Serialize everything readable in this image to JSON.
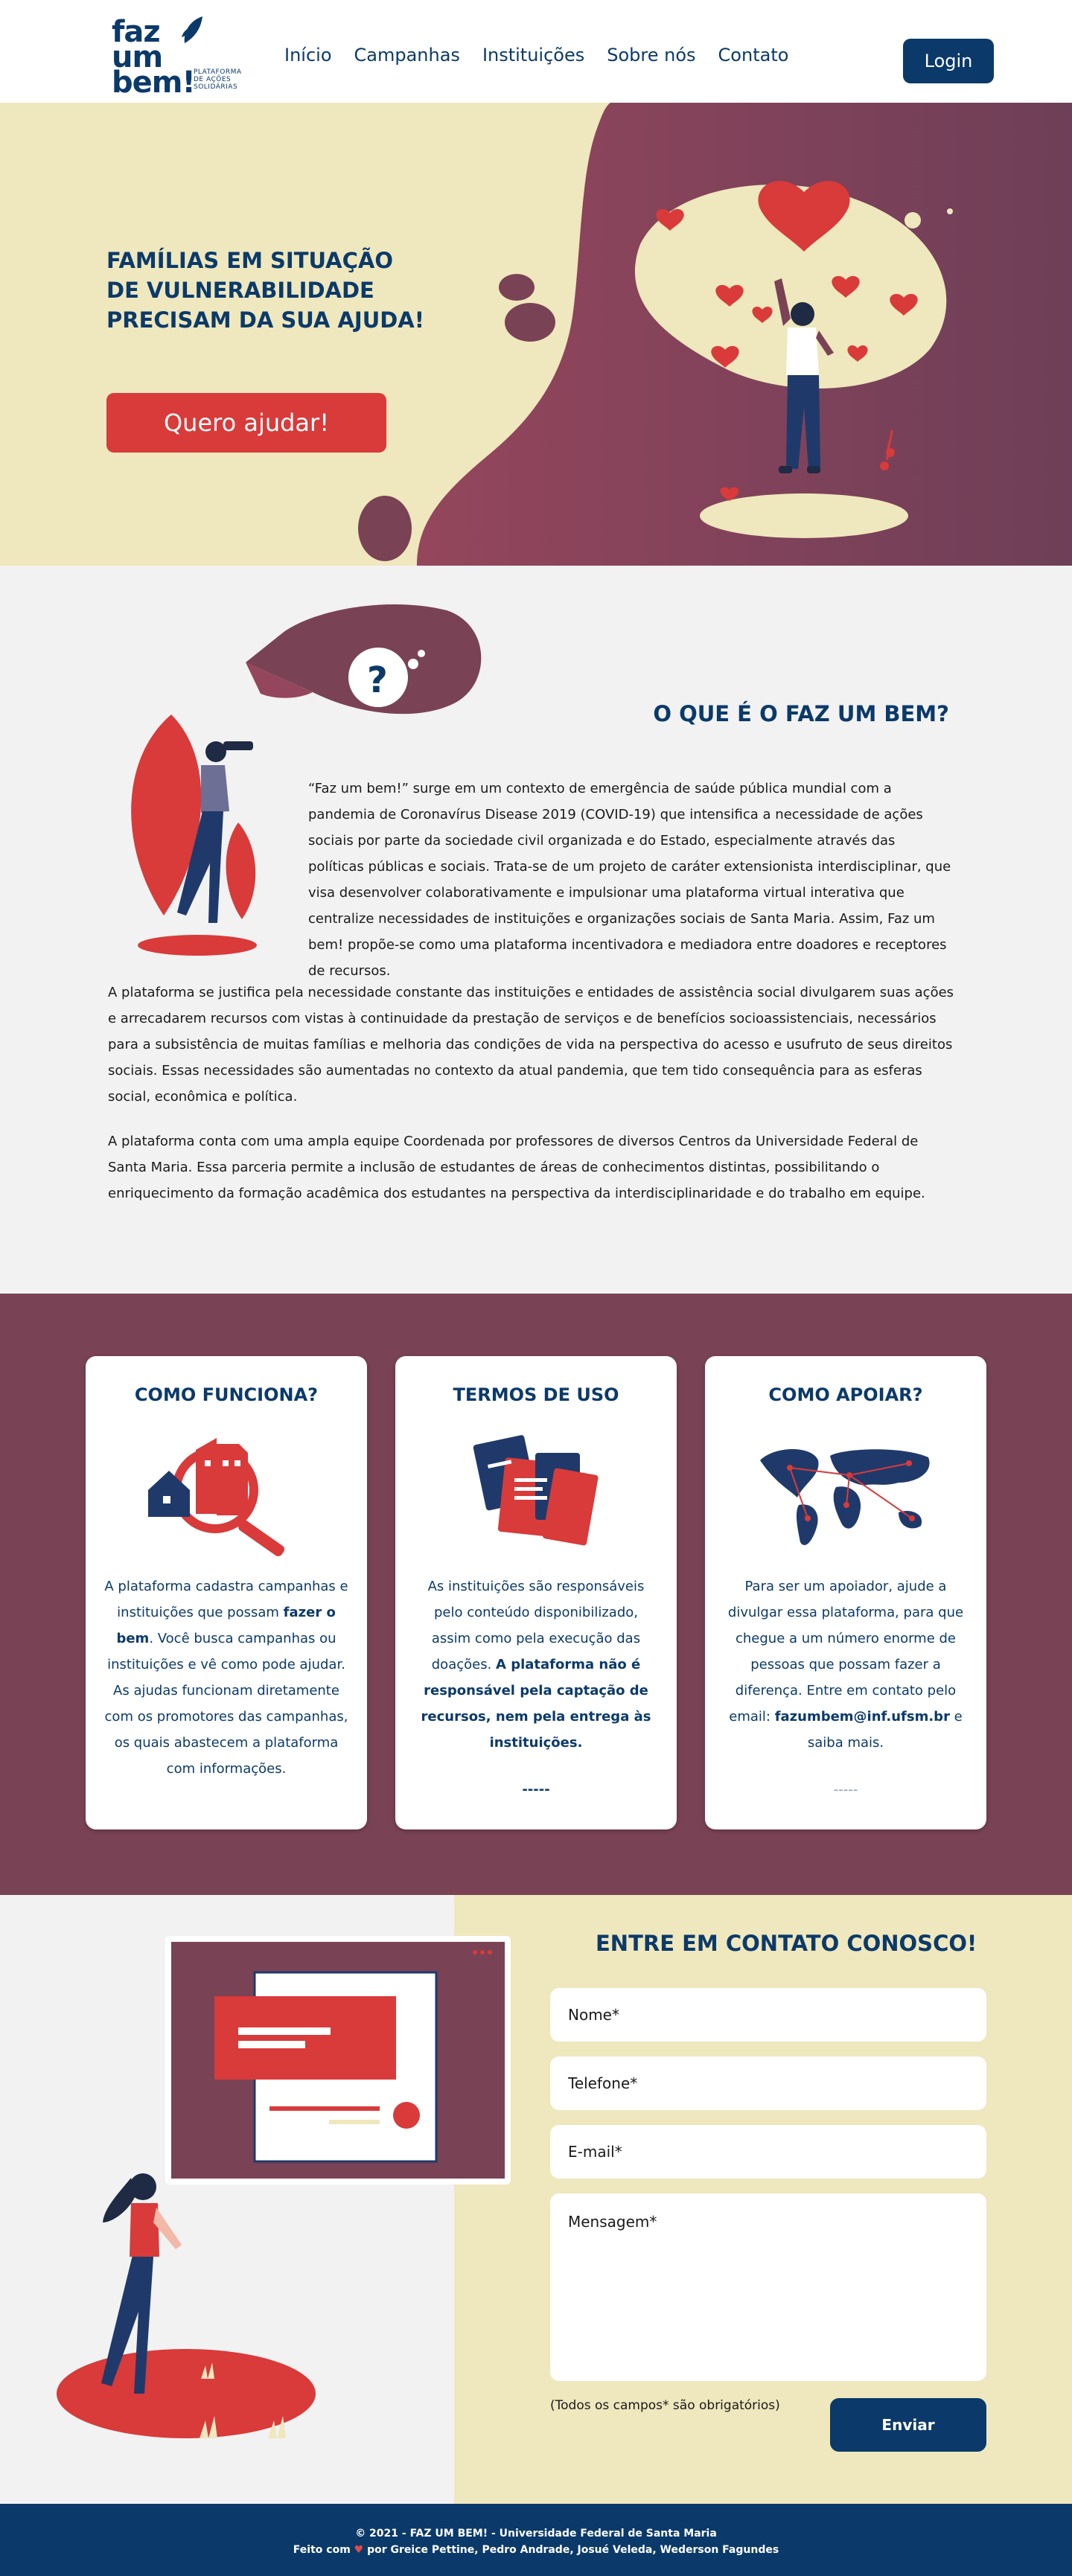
{
  "header": {
    "logo": {
      "word_line1": "faz",
      "word_line2": "um",
      "word_line3": "bem!",
      "subtitle": "PLATAFORMA DE AÇÕES SOLIDÁRIAS"
    },
    "nav": [
      "Início",
      "Campanhas",
      "Instituições",
      "Sobre nós",
      "Contato"
    ],
    "login_label": "Login"
  },
  "hero": {
    "line1": "FAMÍLIAS EM SITUAÇÃO",
    "line2_pre": "DE ",
    "line2_bold": "VULNERABILIDADE",
    "line3_pre": "PRECISAM DA ",
    "line3_bold": "SUA AJUDA!",
    "cta_label": "Quero ajudar!"
  },
  "about": {
    "title_pre": "O QUE É O ",
    "title_bold": "FAZ UM BEM?",
    "p1": "“Faz um bem!” surge em um contexto de emergência de saúde pública mundial com a pandemia de Coronavírus Disease 2019 (COVID-19) que intensifica a necessidade de ações sociais por parte da sociedade civil organizada e do Estado, especialmente através das políticas públicas e sociais. Trata-se de um projeto de caráter extensionista interdisciplinar, que visa desenvolver colaborativamente e impulsionar uma plataforma virtual interativa que centralize necessidades de instituições e organizações sociais de Santa Maria. Assim, Faz um bem! propõe-se como uma plataforma incentivadora e mediadora entre doadores e receptores de recursos.",
    "p2": "A plataforma se justifica pela necessidade constante das instituições e entidades de assistência social divulgarem suas ações e arrecadarem recursos com vistas à continuidade da prestação de serviços e de benefícios socioassistenciais, necessários para a subsistência de muitas famílias e melhoria das condições de vida na perspectiva do acesso e usufruto de seus direitos sociais. Essas necessidades são aumentadas no contexto da atual pandemia, que tem tido consequência para as esferas social, econômica e política.",
    "p3": "A plataforma conta com uma ampla equipe Coordenada por professores de diversos Centros da Universidade Federal de Santa Maria. Essa parceria permite a inclusão de estudantes de áreas de conhecimentos distintas, possibilitando o enriquecimento da formação acadêmica dos estudantes na perspectiva da interdisciplinaridade e do trabalho em equipe."
  },
  "cards": [
    {
      "title": "COMO FUNCIONA?",
      "icon": "house-magnifier-icon",
      "text_pre": "A plataforma cadastra campanhas e instituições que possam ",
      "text_bold": "fazer o bem",
      "text_post": ". Você busca campanhas ou instituições e vê como pode ajudar. As ajudas funcionam diretamente com os promotores das campanhas, os quais abastecem a plataforma com informações.",
      "footer": ""
    },
    {
      "title": "TERMOS DE USO",
      "icon": "documents-icon",
      "text_pre": "As instituições são responsáveis pelo conteúdo disponibilizado, assim como pela execução das doações.  ",
      "text_bold": "A plataforma não é responsável pela captação de recursos, nem pela entrega às instituições.",
      "text_post": "",
      "footer": "-----"
    },
    {
      "title": "COMO APOIAR?",
      "icon": "world-map-icon",
      "text_pre": "Para ser um apoiador, ajude a divulgar essa plataforma, para que chegue a um número enorme de pessoas que possam fazer a diferença. Entre em contato pelo email: ",
      "text_bold": "fazumbem@inf.ufsm.br",
      "text_post": " e saiba mais.",
      "footer": "-----"
    }
  ],
  "contact": {
    "title": "ENTRE EM CONTATO CONOSCO!",
    "name_placeholder": "Nome*",
    "phone_placeholder": "Telefone*",
    "email_placeholder": "E-mail*",
    "message_placeholder": "Mensagem*",
    "required_note": "(Todos os campos* são obrigatórios)",
    "send_label": "Enviar"
  },
  "footer": {
    "line1": "© 2021 - FAZ UM BEM! - Universidade Federal de Santa Maria",
    "line2_pre": "Feito com ",
    "line2_post": " por Greice Pettine, Pedro Andrade, Josué Veleda, Wederson Fagundes"
  },
  "colors": {
    "navy": "#0b3a6a",
    "wine": "#7a4255",
    "cream": "#efe7bd",
    "red": "#d93a3a",
    "light_gray": "#f2f2f2"
  }
}
